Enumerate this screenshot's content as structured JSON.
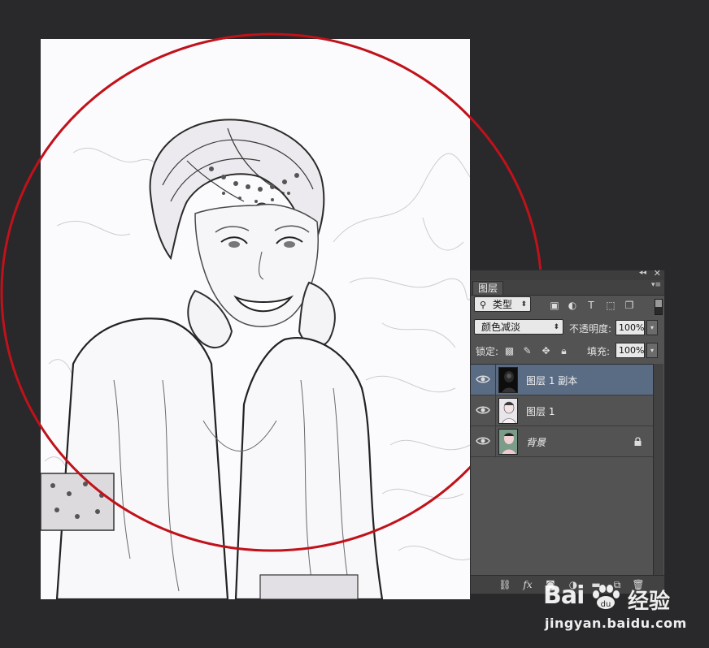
{
  "layers_panel": {
    "tab_label": "图层",
    "filter_kind": "类型",
    "blend_mode": "颜色减淡",
    "opacity_label": "不透明度:",
    "opacity_value": "100%",
    "lock_label": "锁定:",
    "fill_label": "填充:",
    "fill_value": "100%",
    "layers": [
      {
        "name": "图层 1 副本",
        "selected": true,
        "visible": true,
        "locked": false
      },
      {
        "name": "图层 1",
        "selected": false,
        "visible": true,
        "locked": false
      },
      {
        "name": "背景",
        "selected": false,
        "visible": true,
        "locked": true
      }
    ]
  },
  "colors": {
    "workspace_bg": "#29282a",
    "panel_bg": "#535353",
    "selected_layer": "#5a6b84",
    "annotation_circle": "#c0121a"
  },
  "icons": {
    "filter": [
      "search-icon",
      "pixel-layer-icon",
      "adjustment-layer-icon",
      "type-layer-icon",
      "shape-layer-icon",
      "smart-object-icon"
    ],
    "lock": [
      "lock-transparency-icon",
      "lock-paint-icon",
      "lock-position-icon",
      "lock-all-icon"
    ],
    "bottom": [
      "link-icon",
      "fx-icon",
      "mask-icon",
      "adjustment-icon",
      "group-icon",
      "new-layer-icon",
      "trash-icon"
    ]
  },
  "watermark": {
    "logo": "Bai",
    "brand_cn": "经验",
    "url": "jingyan.baidu.com"
  }
}
